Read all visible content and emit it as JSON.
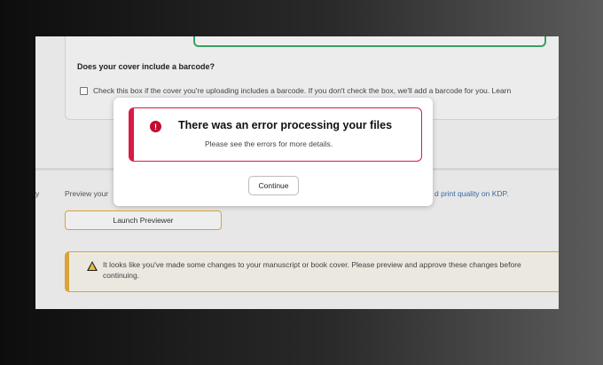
{
  "background_section": {
    "barcode_question": "Does your cover include a barcode?",
    "barcode_checkbox_text": "Check this box if the cover you're uploading includes a barcode. If you don't check the box, we'll add a barcode for you. Learn",
    "left_marker": "y",
    "preview_text": "Preview your",
    "preview_tail": "d print quality on KDP.",
    "launch_previewer_label": "Launch Previewer",
    "warning_text": "It looks like you've made some changes to your manuscript or book cover. Please preview and approve these changes before continuing."
  },
  "modal": {
    "error_title": "There was an error processing your files",
    "error_subtitle": "Please see the errors for more details.",
    "error_icon_glyph": "!",
    "continue_label": "Continue"
  },
  "colors": {
    "error_red": "#d81b43",
    "warning_orange": "#e0a93a",
    "success_green": "#3aa66a"
  },
  "icons": [
    "error-icon",
    "warning-icon"
  ]
}
